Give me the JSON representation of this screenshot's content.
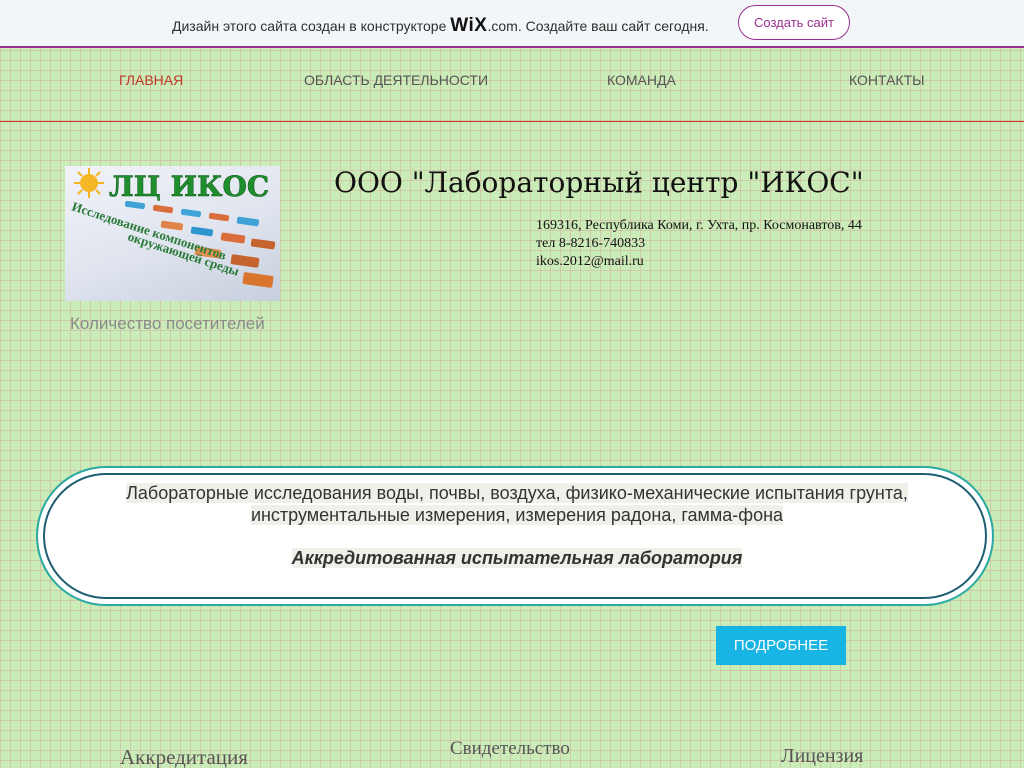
{
  "banner": {
    "text_before": "Дизайн этого сайта создан в конструкторе",
    "logo": "WiX",
    "logo_suffix": ".com",
    "text_after": ". Создайте ваш сайт сегодня.",
    "button_label": "Создать сайт"
  },
  "nav": {
    "items": [
      {
        "label": "ГЛАВНАЯ",
        "active": true
      },
      {
        "label": "ОБЛАСТЬ ДЕЯТЕЛЬНОСТИ",
        "active": false
      },
      {
        "label": "КОМАНДА",
        "active": false
      },
      {
        "label": "КОНТАКТЫ",
        "active": false
      }
    ]
  },
  "logo": {
    "title": "ЛЦ ИКОС",
    "subtitle_line1": "Исследование компонентов",
    "subtitle_line2": "окружающей среды"
  },
  "visitors_label": "Количество посетителей",
  "company": {
    "title": "ООО \"Лабораторный центр \"ИКОС\"",
    "address": "169316, Республика Коми, г. Ухта, пр. Космонавтов, 44",
    "phone": "тел 8-8216-740833",
    "email": "ikos.2012@mail.ru"
  },
  "services": {
    "line1": "Лабораторные исследования воды, почвы, воздуха, физико-механические испытания грунта,",
    "line2": "инструментальные измерения, измерения  радона, гамма-фона",
    "accent": "Аккредитованная испытательная лаборатория"
  },
  "more_button": "ПОДРОБНЕЕ",
  "documents": {
    "accreditation": "Аккредитация",
    "certificate": "Свидетельство",
    "license": "Лицензия"
  },
  "colors": {
    "background": "#c9ecb8",
    "accent_red": "#c0392b",
    "wix_purple": "#9b2f8f",
    "button_blue": "#18b4e3"
  }
}
